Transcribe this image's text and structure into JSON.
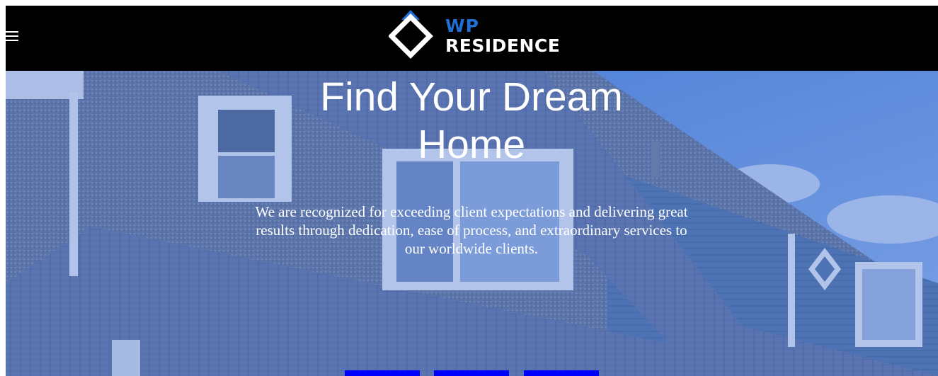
{
  "header": {
    "menu_icon": "hamburger-menu-icon",
    "logo": {
      "line1": "WP",
      "line2": "RESIDENCE",
      "mark_icon": "diamond-house-logo-icon"
    }
  },
  "hero": {
    "title_line1": "Find Your Dream",
    "title_line2": "Home",
    "subtitle": "We are recognized for exceeding client expectations and delivering great results through dedication, ease of process, and extraordinary services to our worldwide clients.",
    "background": "house-photo",
    "buttons": [
      "",
      "",
      ""
    ]
  },
  "colors": {
    "header_bg": "#000000",
    "brand_blue": "#1f6fd6",
    "button_blue": "#0000ff",
    "text": "#ffffff"
  }
}
